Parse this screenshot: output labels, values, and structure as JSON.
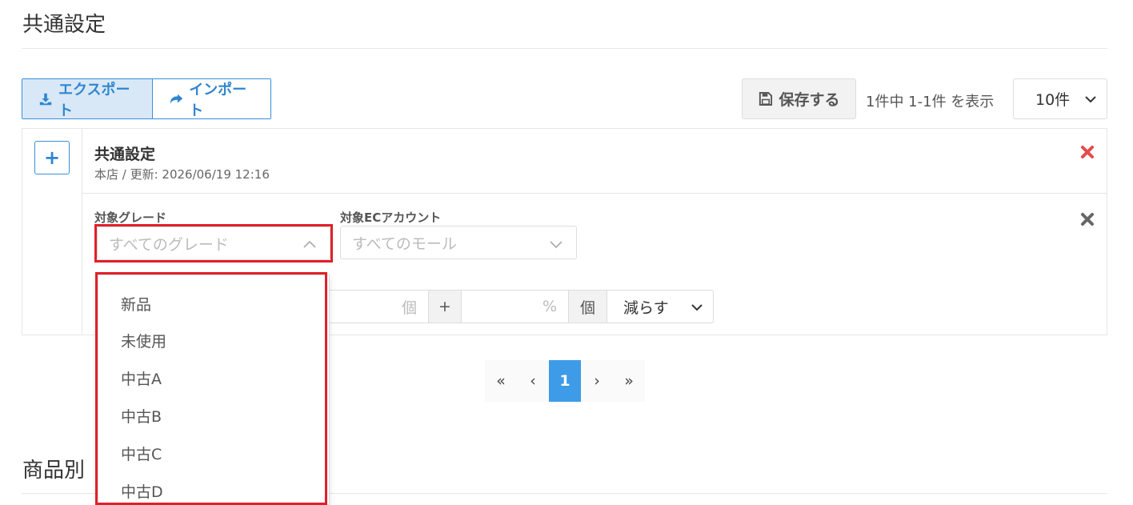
{
  "page": {
    "title": "共通設定",
    "section2_title": "商品別"
  },
  "toolbar": {
    "export_label": "エクスポート",
    "import_label": "インポート",
    "save_label": "保存する",
    "count_text": "1件中 1-1件 を表示",
    "per_page": "10件"
  },
  "rule": {
    "name": "共通設定",
    "meta": "本店 / 更新: 2026/06/19 12:16",
    "grade_label": "対象グレード",
    "grade_placeholder": "すべてのグレード",
    "ec_label": "対象ECアカウント",
    "ec_placeholder": "すべてのモール",
    "unit_piece": "個",
    "plus": "+",
    "percent": "%",
    "unit_piece2": "個",
    "mode": "減らす"
  },
  "grade_options": [
    "新品",
    "未使用",
    "中古A",
    "中古B",
    "中古C",
    "中古D"
  ],
  "pagination": {
    "first": "«",
    "prev": "‹",
    "current": "1",
    "next": "›",
    "last": "»"
  },
  "colors": {
    "accent": "#2f86d0",
    "active_page": "#3d9be8",
    "delete": "#e44c4c",
    "highlight": "#e0202a"
  }
}
